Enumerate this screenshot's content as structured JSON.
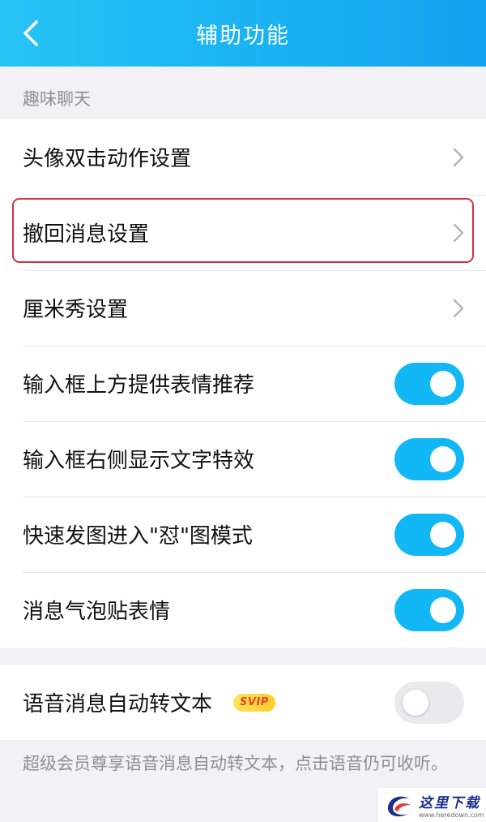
{
  "header": {
    "title": "辅助功能",
    "back_icon": "chevron-left-icon"
  },
  "section": {
    "label": "趣味聊天"
  },
  "nav_items": [
    {
      "label": "头像双击动作设置",
      "icon": "chevron-right-icon"
    },
    {
      "label": "撤回消息设置",
      "icon": "chevron-right-icon",
      "highlighted": true
    },
    {
      "label": "厘米秀设置",
      "icon": "chevron-right-icon"
    }
  ],
  "toggle_items": [
    {
      "label": "输入框上方提供表情推荐",
      "state": "on"
    },
    {
      "label": "输入框右侧显示文字特效",
      "state": "on"
    },
    {
      "label": "快速发图进入\"怼\"图模式",
      "state": "on"
    },
    {
      "label": "消息气泡贴表情",
      "state": "on"
    }
  ],
  "voice_item": {
    "label": "语音消息自动转文本",
    "badge": "SVIP",
    "state": "off"
  },
  "note": "超级会员尊享语音消息自动转文本，点击语音仍可收听。",
  "watermark": {
    "name": "这里下载",
    "url": "www.heredown.com"
  },
  "colors": {
    "header_gradient": [
      "#27c4f5",
      "#12a3f0"
    ],
    "toggle_on": "#12b7f5",
    "toggle_off": "#e9e9ee",
    "highlight_border": "#d2323e",
    "badge_bg": "#ffd93a",
    "badge_text": "#e8412c"
  }
}
